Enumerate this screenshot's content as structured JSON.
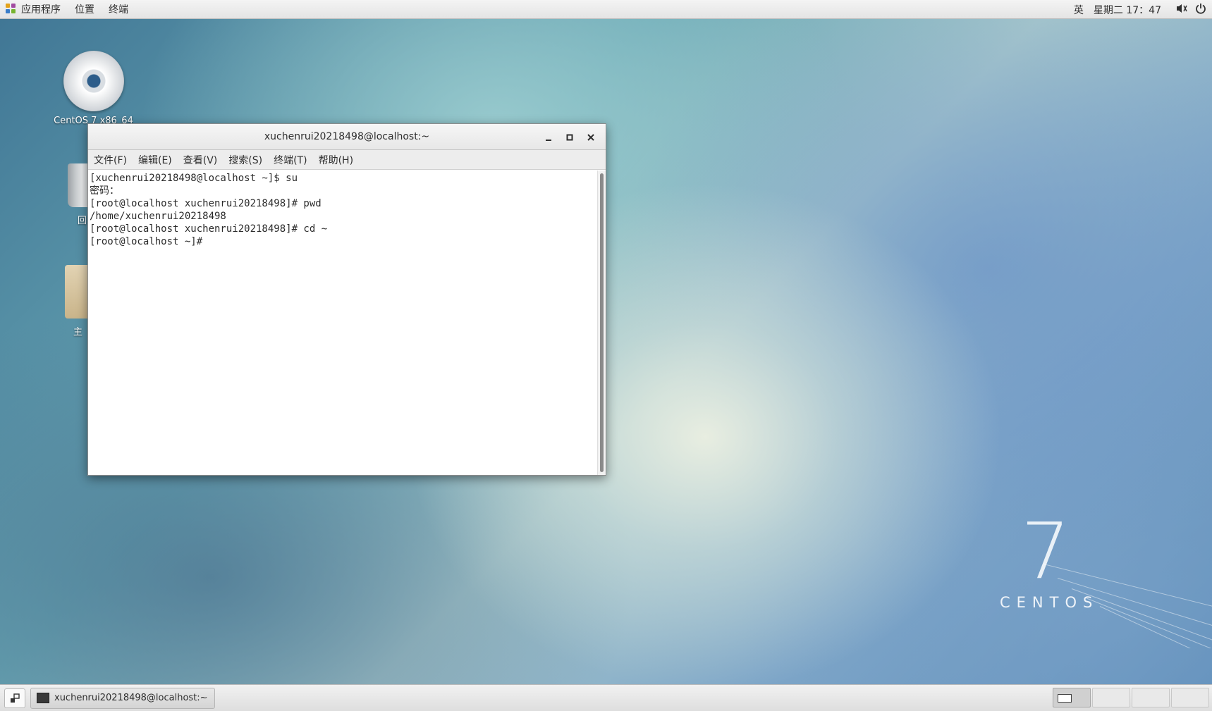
{
  "top_panel": {
    "applications": "应用程序",
    "places": "位置",
    "terminal": "终端",
    "input_method": "英",
    "datetime": "星期二 17：47"
  },
  "desktop_icons": [
    {
      "label": "CentOS 7 x86_64"
    },
    {
      "label": "回"
    },
    {
      "label": "主"
    }
  ],
  "window": {
    "title": "xuchenrui20218498@localhost:~",
    "menu": [
      "文件(F)",
      "编辑(E)",
      "查看(V)",
      "搜索(S)",
      "终端(T)",
      "帮助(H)"
    ],
    "lines": [
      "[xuchenrui20218498@localhost ~]$ su",
      "密码：",
      "[root@localhost xuchenrui20218498]# pwd",
      "/home/xuchenrui20218498",
      "[root@localhost xuchenrui20218498]# cd ~",
      "[root@localhost ~]# "
    ]
  },
  "wallpaper": {
    "logo_number": "7",
    "logo_text": "CENTOS"
  },
  "taskbar": {
    "task_label": "xuchenrui20218498@localhost:~",
    "workspace_count": 4,
    "active_workspace": 1
  }
}
